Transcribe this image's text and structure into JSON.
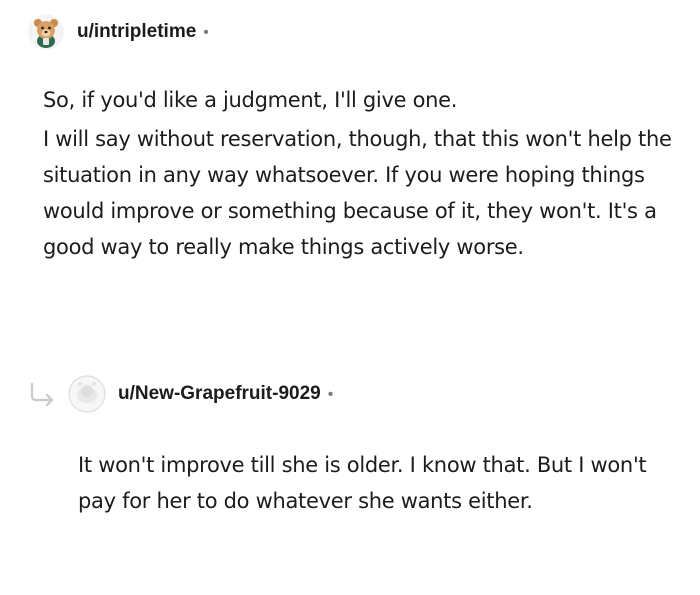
{
  "comments": [
    {
      "username": "u/intripletime",
      "separator": "•",
      "avatar_icon": "bear-avatar-icon",
      "paragraphs": [
        "So, if you'd like a judgment, I'll give one.",
        "I will say without reservation, though, that this won't help the situation in any way whatsoever. If you were hoping things would improve or something because of it, they won't. It's a good way to really make things actively worse."
      ]
    },
    {
      "username": "u/New-Grapefruit-9029",
      "separator": "•",
      "reply_icon": "reply-arrow-icon",
      "avatar_icon": "default-avatar-icon",
      "paragraphs": [
        "It won't improve till she is older. I know that. But I won't pay for her to do whatever she wants either."
      ]
    }
  ],
  "colors": {
    "text": "#1c1c1c",
    "meta": "#7c7c7c",
    "reply_line": "#c9c9c9"
  }
}
